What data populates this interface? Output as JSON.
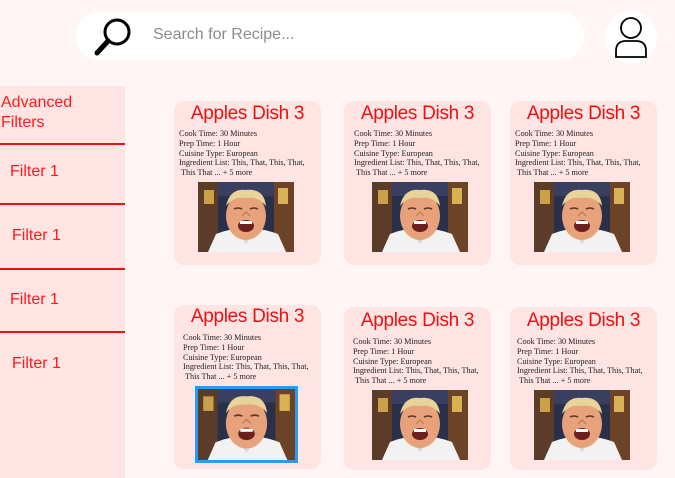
{
  "search": {
    "placeholder": "Search for Recipe..."
  },
  "sidebar": {
    "heading_line1": "Advanced",
    "heading_line2": "Filters",
    "filters": [
      {
        "label": "Filter 1"
      },
      {
        "label": "Filter 1"
      },
      {
        "label": "Filter 1"
      },
      {
        "label": "Filter 1"
      }
    ]
  },
  "cards": [
    {
      "title": "Apples Dish 3",
      "cook_time": "Cook Time: 30 Minutes",
      "prep_time": "Prep Time: 1 Hour",
      "cuisine": "Cuisine Type: European",
      "ingredients_1": "Ingredient List: This, That, This, That,",
      "ingredients_2": "This That ... + 5 more"
    },
    {
      "title": "Apples Dish 3",
      "cook_time": "Cook Time: 30 Minutes",
      "prep_time": "Prep Time: 1 Hour",
      "cuisine": "Cuisine Type: European",
      "ingredients_1": "Ingredient List: This, That, This, That,",
      "ingredients_2": "This That ... + 5 more"
    },
    {
      "title": "Apples Dish 3",
      "cook_time": "Cook Time: 30 Minutes",
      "prep_time": "Prep Time: 1 Hour",
      "cuisine": "Cuisine Type: European",
      "ingredients_1": "Ingredient List: This, That, This, That,",
      "ingredients_2": "This That ... + 5 more"
    },
    {
      "title": "Apples Dish 3",
      "cook_time": "Cook Time: 30 Minutes",
      "prep_time": "Prep Time: 1 Hour",
      "cuisine": "Cuisine Type: European",
      "ingredients_1": "Ingredient List: This, That, This, That,",
      "ingredients_2": "This That ... + 5 more"
    },
    {
      "title": "Apples Dish 3",
      "cook_time": "Cook Time: 30 Minutes",
      "prep_time": "Prep Time: 1 Hour",
      "cuisine": "Cuisine Type: European",
      "ingredients_1": "Ingredient List: This, That, This, That,",
      "ingredients_2": "This That ... + 5 more"
    },
    {
      "title": "Apples Dish 3",
      "cook_time": "Cook Time: 30 Minutes",
      "prep_time": "Prep Time: 1 Hour",
      "cuisine": "Cuisine Type: European",
      "ingredients_1": "Ingredient List: This, That, This, That,",
      "ingredients_2": "This That ... + 5 more"
    }
  ],
  "icons": {
    "search": "search-icon",
    "user": "user-icon",
    "recipe_image": "chef-photo"
  },
  "colors": {
    "accent": "#ee1111",
    "card_bg": "#ffe4e4",
    "page_bg": "#fff5f5",
    "selection": "#2b9bf0"
  }
}
